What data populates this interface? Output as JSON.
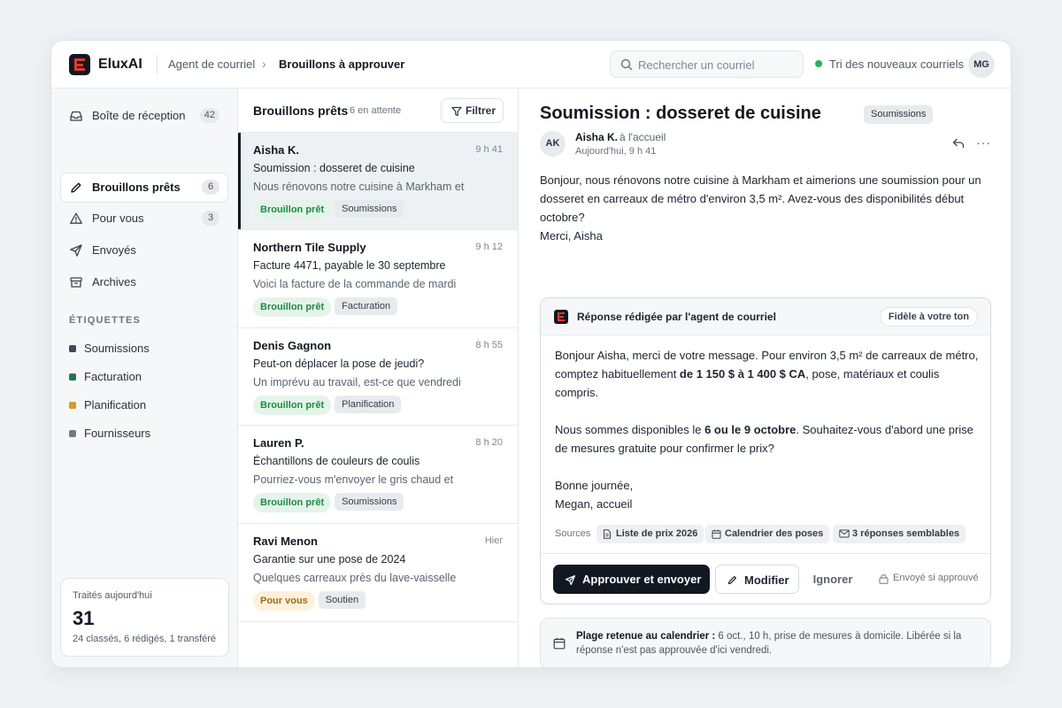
{
  "header": {
    "brand": "EluxAI",
    "breadcrumb_parent": "Agent de courriel",
    "breadcrumb_current": "Brouillons à approuver",
    "search_placeholder": "Rechercher un courriel",
    "status_text": "Tri des nouveaux courriels",
    "user_initials": "MG",
    "status_color": "#22b35e"
  },
  "sidebar": {
    "items": [
      {
        "label": "Boîte de réception",
        "count": "42",
        "icon": "inbox-icon"
      },
      {
        "label": "Brouillons prêts",
        "count": "6",
        "icon": "pencil-icon"
      },
      {
        "label": "Pour vous",
        "count": "3",
        "icon": "warning-icon"
      },
      {
        "label": "Envoyés",
        "count": "",
        "icon": "send-icon"
      },
      {
        "label": "Archives",
        "count": "",
        "icon": "archive-icon"
      }
    ],
    "labels_heading": "ÉTIQUETTES",
    "labels": [
      {
        "label": "Soumissions",
        "color": "#3e4a59"
      },
      {
        "label": "Facturation",
        "color": "#23774a"
      },
      {
        "label": "Planification",
        "color": "#d69a2d"
      },
      {
        "label": "Fournisseurs",
        "color": "#6f7987"
      }
    ],
    "stats": {
      "title": "Traités aujourd'hui",
      "value": "31",
      "subtitle": "24 classés, 6 rédigés, 1 transféré"
    }
  },
  "list": {
    "title": "Brouillons prêts",
    "count": "6 en attente",
    "filter_label": "Filtrer",
    "rows": [
      {
        "sender": "Aisha K.",
        "time": "9 h 41",
        "subject": "Soumission : dosseret de cuisine",
        "preview": "Nous rénovons notre cuisine à Markham et",
        "status": "Brouillon prêt",
        "tag": "Soumissions"
      },
      {
        "sender": "Northern Tile Supply",
        "time": "9 h 12",
        "subject": "Facture 4471, payable le 30 septembre",
        "preview": "Voici la facture de la commande de mardi",
        "status": "Brouillon prêt",
        "tag": "Facturation"
      },
      {
        "sender": "Denis Gagnon",
        "time": "8 h 55",
        "subject": "Peut-on déplacer la pose de jeudi?",
        "preview": "Un imprévu au travail, est-ce que vendredi",
        "status": "Brouillon prêt",
        "tag": "Planification"
      },
      {
        "sender": "Lauren P.",
        "time": "8 h 20",
        "subject": "Échantillons de couleurs de coulis",
        "preview": "Pourriez-vous m'envoyer le gris chaud et",
        "status": "Brouillon prêt",
        "tag": "Soumissions"
      },
      {
        "sender": "Ravi Menon",
        "time": "Hier",
        "subject": "Garantie sur une pose de 2024",
        "preview": "Quelques carreaux près du lave-vaisselle",
        "status": "Pour vous",
        "tag": "Soutien"
      }
    ]
  },
  "detail": {
    "title": "Soumission : dosseret de cuisine",
    "badge": "Soumissions",
    "sender_initials": "AK",
    "sender_name": "Aisha K.",
    "sender_to": "à l'accueil",
    "sender_time": "Aujourd'hui, 9 h 41",
    "more_glyph": "···",
    "message_line1": "Bonjour, nous rénovons notre cuisine à Markham et aimerions une soumission pour un dosseret en carreaux de métro d'environ 3,5 m². Avez-vous des disponibilités début octobre?",
    "message_line2": "Merci, Aisha",
    "draft": {
      "header": "Réponse rédigée par l'agent de courriel",
      "tone": "Fidèle à votre ton",
      "p1_a": "Bonjour Aisha, merci de votre message. Pour environ 3,5 m² de carreaux de métro, comptez habituellement ",
      "p1_b": "de 1 150 $ à 1 400 $ CA",
      "p1_c": ", pose, matériaux et coulis compris.",
      "p2_a": "Nous sommes disponibles le ",
      "p2_b": "6 ou le 9 octobre",
      "p2_c": ". Souhaitez-vous d'abord une prise de mesures gratuite pour confirmer le prix?",
      "closing1": "Bonne journée,",
      "closing2": "Megan, accueil",
      "sources_label": "Sources",
      "sources": [
        "Liste de prix 2026",
        "Calendrier des poses",
        "3 réponses semblables"
      ],
      "approve_label": "Approuver et envoyer",
      "edit_label": "Modifier",
      "ignore_label": "Ignorer",
      "lock_note": "Envoyé si approuvé"
    },
    "calendar": {
      "bold": "Plage retenue au calendrier :",
      "text": " 6 oct., 10 h, prise de mesures à domicile. Libérée si la réponse n'est pas approuvée d'ici vendredi."
    }
  }
}
